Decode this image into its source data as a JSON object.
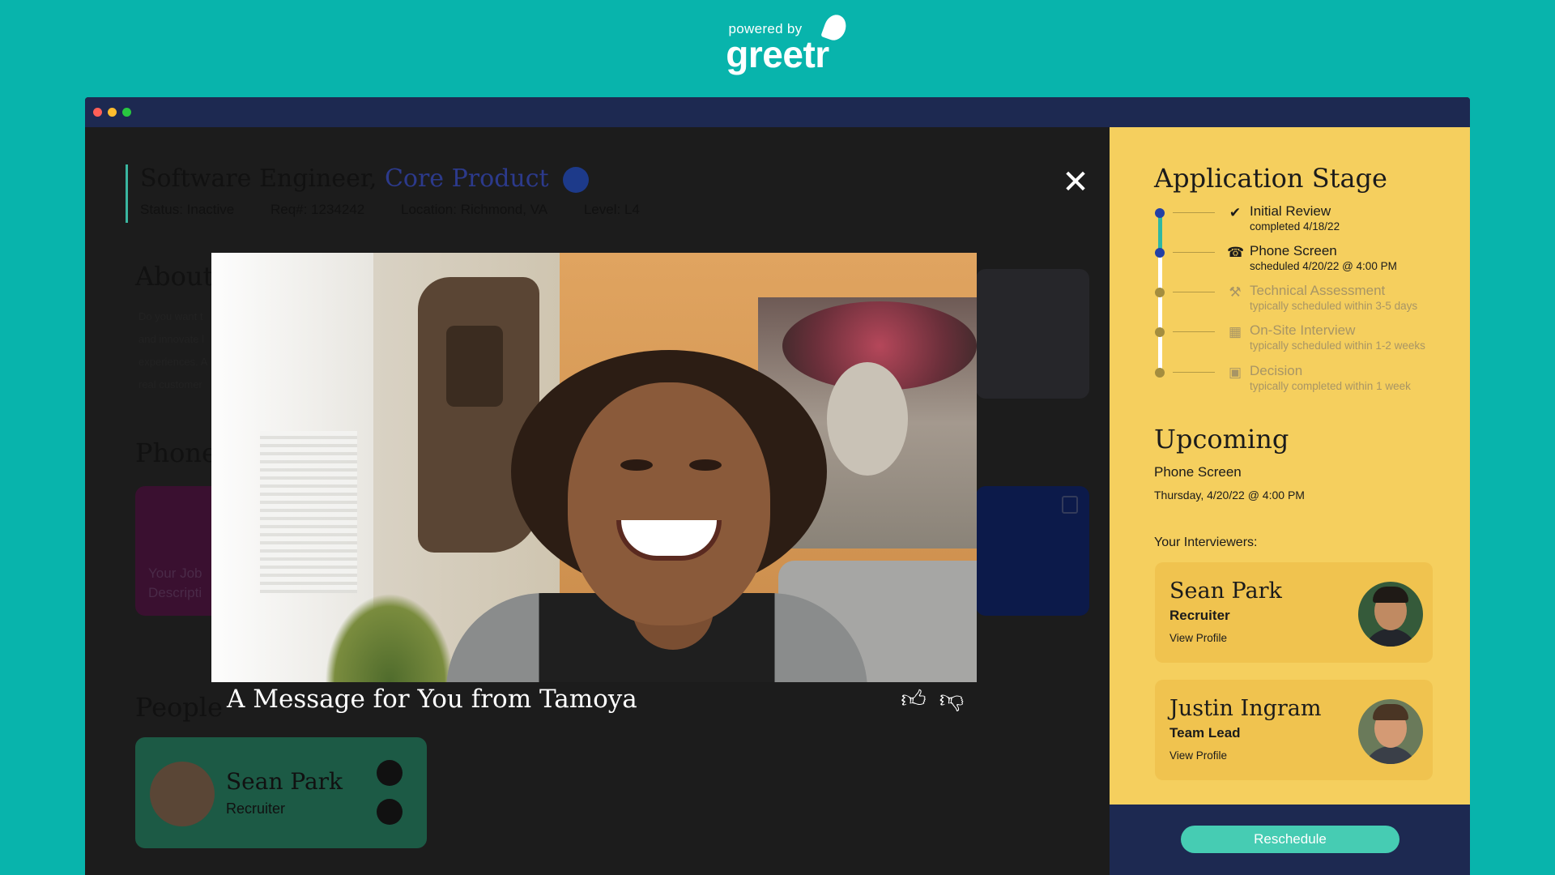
{
  "brand": {
    "powered_by": "powered by",
    "name": "greetr"
  },
  "job": {
    "title": "Software Engineer,",
    "department": "Core Product",
    "status": "Status: Inactive",
    "req": "Req#: 1234242",
    "location": "Location: Richmond, VA",
    "level": "Level: L4"
  },
  "background": {
    "about_title": "About",
    "about_text": "Do you want t and innovate l experiences. A real customer",
    "phone_title": "Phone",
    "jobdesc_text": "Your Job Descripti",
    "people_title": "People",
    "person_name": "Sean Park",
    "person_role": "Recruiter"
  },
  "video": {
    "caption": "A Message for You from Tamoya",
    "close_icon": "close-icon",
    "thumbs_up_icon": "thumbs-up-icon",
    "thumbs_down_icon": "thumbs-down-icon"
  },
  "sidebar": {
    "stage_title": "Application Stage",
    "stages": [
      {
        "name": "Initial Review",
        "sub": "completed 4/18/22",
        "state": "done",
        "icon": "person-check-icon"
      },
      {
        "name": "Phone Screen",
        "sub": "scheduled 4/20/22 @ 4:00 PM",
        "state": "current",
        "icon": "phone-icon"
      },
      {
        "name": "Technical Assessment",
        "sub": "typically scheduled within 3-5 days",
        "state": "pending",
        "icon": "wrench-icon"
      },
      {
        "name": "On-Site Interview",
        "sub": "typically scheduled within 1-2 weeks",
        "state": "pending",
        "icon": "building-icon"
      },
      {
        "name": "Decision",
        "sub": "typically completed within 1 week",
        "state": "pending",
        "icon": "person-frame-icon"
      }
    ],
    "upcoming_title": "Upcoming",
    "upcoming_type": "Phone Screen",
    "upcoming_date": "Thursday, 4/20/22 @ 4:00 PM",
    "interviewers_label": "Your Interviewers:",
    "interviewers": [
      {
        "name": "Sean Park",
        "role": "Recruiter",
        "link": "View Profile"
      },
      {
        "name": "Justin Ingram",
        "role": "Team Lead",
        "link": "View Profile"
      }
    ],
    "reschedule_label": "Reschedule"
  },
  "colors": {
    "page_bg": "#08b4ac",
    "navy": "#1d2951",
    "sidebar_yellow": "#f5cf5e",
    "accent_teal": "#46ccb3",
    "stage_current": "#2340a5"
  }
}
